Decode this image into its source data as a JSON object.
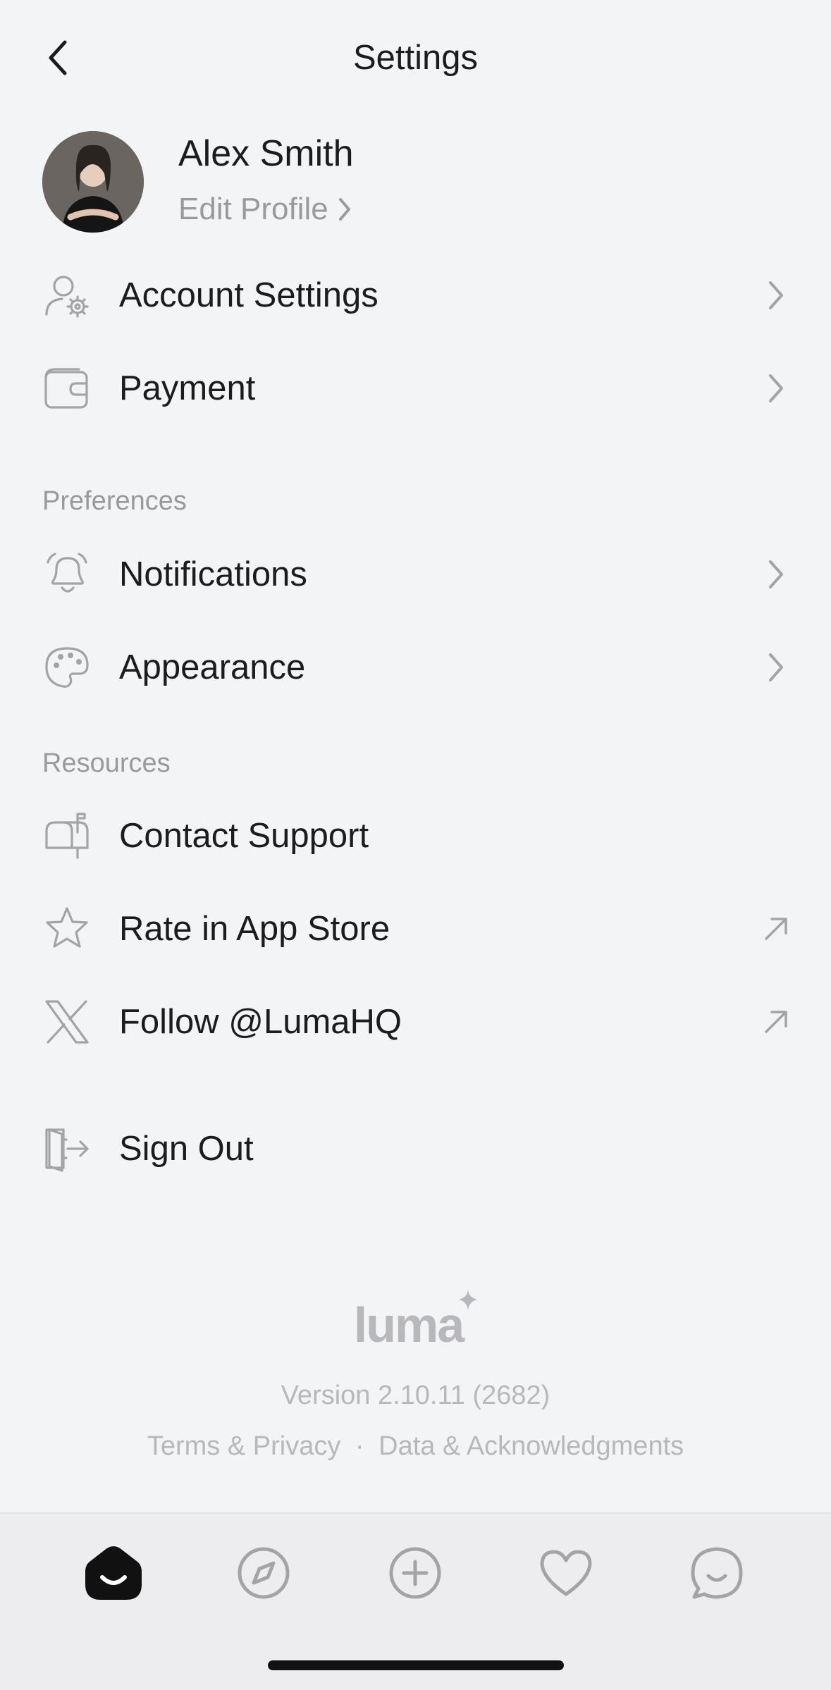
{
  "header": {
    "title": "Settings"
  },
  "profile": {
    "name": "Alex Smith",
    "edit_label": "Edit Profile"
  },
  "account_items": [
    {
      "label": "Account Settings"
    },
    {
      "label": "Payment"
    }
  ],
  "preferences": {
    "heading": "Preferences",
    "items": [
      {
        "label": "Notifications"
      },
      {
        "label": "Appearance"
      }
    ]
  },
  "resources": {
    "heading": "Resources",
    "items": [
      {
        "label": "Contact Support"
      },
      {
        "label": "Rate in App Store"
      },
      {
        "label": "Follow @LumaHQ"
      }
    ]
  },
  "sign_out": {
    "label": "Sign Out"
  },
  "footer": {
    "brand": "luma",
    "version": "Version 2.10.11 (2682)",
    "terms": "Terms & Privacy",
    "separator": "·",
    "data": "Data & Acknowledgments"
  },
  "tabbar": {
    "items": [
      {
        "icon": "home-icon",
        "active": true
      },
      {
        "icon": "compass-icon",
        "active": false
      },
      {
        "icon": "plus-circle-icon",
        "active": false
      },
      {
        "icon": "heart-icon",
        "active": false
      },
      {
        "icon": "chat-icon",
        "active": false
      }
    ]
  },
  "colors": {
    "background": "#f3f4f6",
    "text": "#1c1c1e",
    "muted": "#9a9a9e",
    "footer": "#b8b8bc"
  }
}
